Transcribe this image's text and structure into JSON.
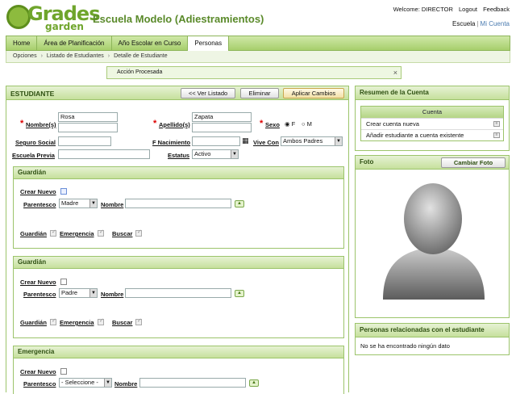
{
  "header": {
    "logo_top": "Grades",
    "logo_bottom": "garden",
    "school": "Escuela Modelo (Adiestramientos)",
    "welcome": "Welcome: DIRECTOR",
    "logout": "Logout",
    "feedback": "Feedback",
    "school_link": "Escuela",
    "account_link": "Mi Cuenta"
  },
  "nav": {
    "tabs": [
      "Home",
      "Área de Planificación",
      "Año Escolar en Curso",
      "Personas"
    ]
  },
  "breadcrumb": [
    "Opciones",
    "Listado de Estudiantes",
    "Detalle de Estudiante"
  ],
  "message": {
    "text": "Acción Procesada",
    "close": "×"
  },
  "student": {
    "title": "ESTUDIANTE",
    "back_button": "<< Ver Listado",
    "delete_button": "Eliminar",
    "apply_button": "Aplicar Cambios",
    "name_label": "Nombre(s)",
    "name_value": "Rosa",
    "last_label": "Apellido(s)",
    "last_value": "Zapata",
    "sex_label": "Sexo",
    "sex_f": "F",
    "sex_m": "M",
    "ssn_label": "Seguro Social",
    "birth_label": "F Nacimiento",
    "lives_label": "Vive Con",
    "lives_value": "Ambos Padres",
    "prev_label": "Escuela Previa",
    "status_label": "Estatus",
    "status_value": "Activo"
  },
  "guardians": [
    {
      "title": "Guardián",
      "new_label": "Crear Nuevo",
      "rel_label": "Parentesco",
      "rel_value": "Madre",
      "name_label": "Nombre",
      "g_label": "Guardián",
      "e_label": "Emergencia",
      "s_label": "Buscar"
    },
    {
      "title": "Guardián",
      "new_label": "Crear Nuevo",
      "rel_label": "Parentesco",
      "rel_value": "Padre",
      "name_label": "Nombre",
      "g_label": "Guardián",
      "e_label": "Emergencia",
      "s_label": "Buscar"
    },
    {
      "title": "Emergencia",
      "new_label": "Crear Nuevo",
      "rel_label": "Parentesco",
      "rel_value": "- Seleccione -",
      "name_label": "Nombre"
    }
  ],
  "account": {
    "title": "Resumen de la Cuenta",
    "box_title": "Cuenta",
    "items": [
      "Crear cuenta nueva",
      "Añadir estudiante a cuenta existente"
    ]
  },
  "photo": {
    "title": "Foto",
    "button": "Cambiar Foto"
  },
  "related": {
    "title": "Personas relacionadas con el estudiante",
    "empty": "No se ha encontrado ningún dato"
  }
}
